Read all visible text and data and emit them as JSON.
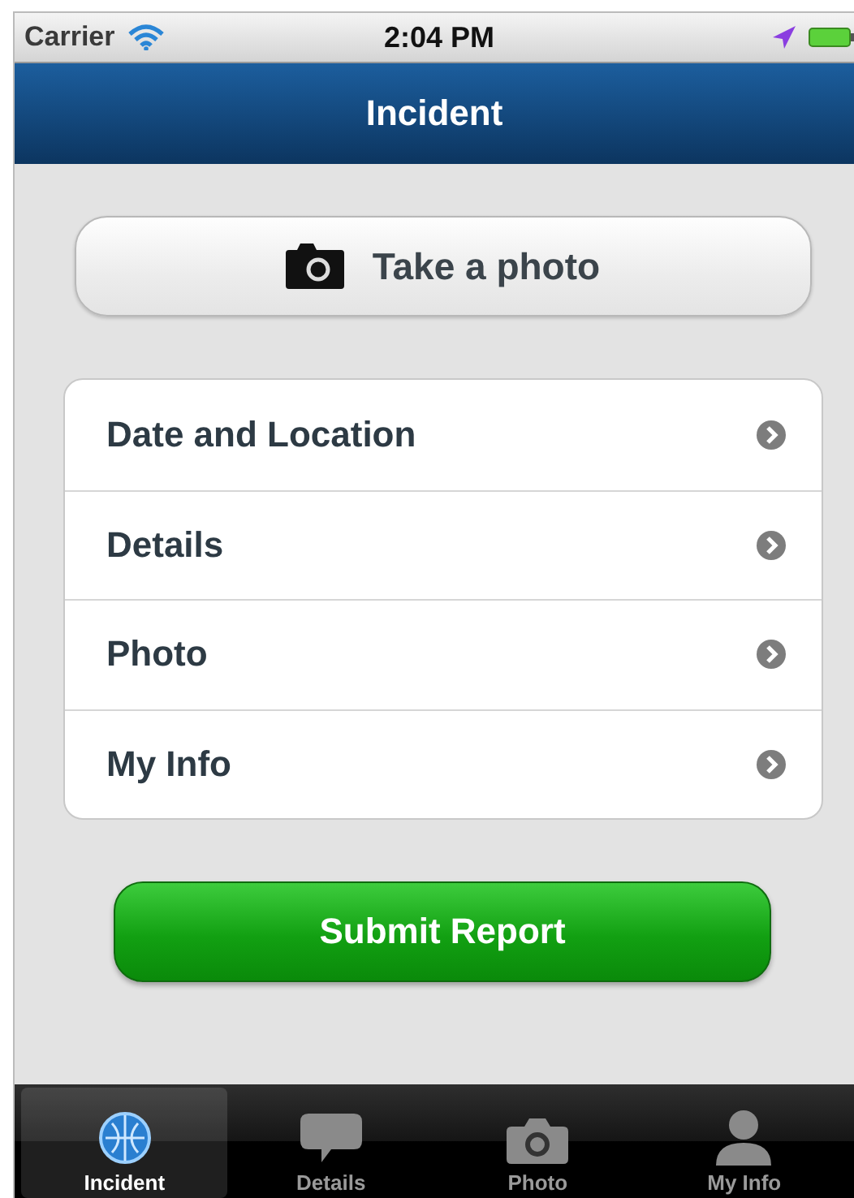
{
  "status_bar": {
    "carrier": "Carrier",
    "time": "2:04 PM"
  },
  "nav_bar": {
    "title": "Incident"
  },
  "photo_button": {
    "label": "Take a photo"
  },
  "menu": [
    {
      "label": "Date and Location"
    },
    {
      "label": "Details"
    },
    {
      "label": "Photo"
    },
    {
      "label": "My Info"
    }
  ],
  "submit_button": {
    "label": "Submit Report"
  },
  "tab_bar": [
    {
      "label": "Incident",
      "kind": "globe",
      "selected": true
    },
    {
      "label": "Details",
      "kind": "bubble",
      "selected": false
    },
    {
      "label": "Photo",
      "kind": "camera",
      "selected": false
    },
    {
      "label": "My Info",
      "kind": "person",
      "selected": false
    }
  ]
}
